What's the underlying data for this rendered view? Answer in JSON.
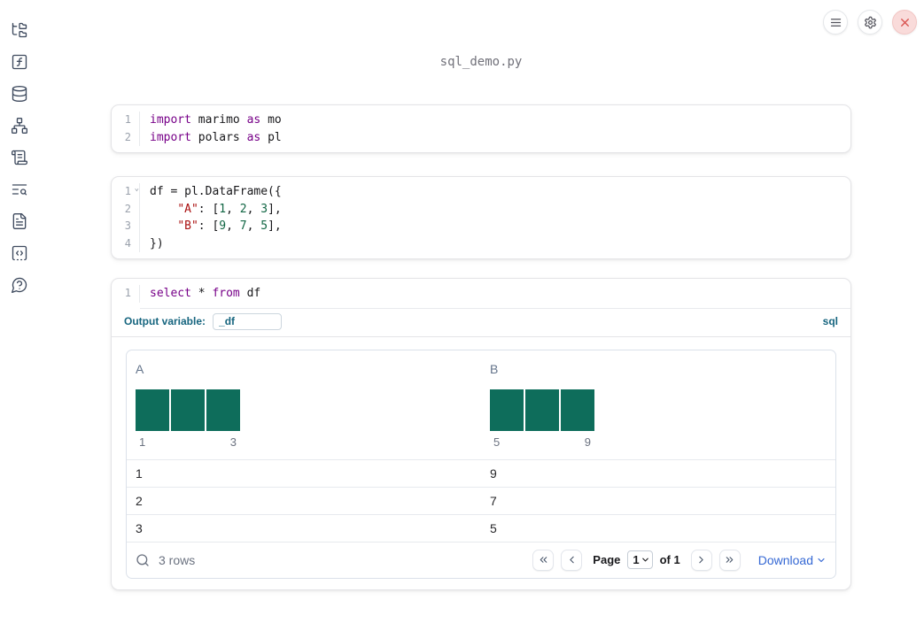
{
  "header": {
    "filename": "sql_demo.py",
    "buttons": {
      "menu": "menu-icon",
      "settings": "gear-icon",
      "close": "close-icon"
    }
  },
  "sidebar": {
    "icons": [
      "file-tree-icon",
      "function-square-icon",
      "database-icon",
      "dependency-graph-icon",
      "scratchpad-icon",
      "logs-search-icon",
      "documentation-icon",
      "snippets-icon",
      "help-icon"
    ]
  },
  "cells": [
    {
      "kind": "python",
      "lines": [
        {
          "n": "1",
          "tokens": [
            {
              "t": "kw",
              "v": "import"
            },
            {
              "t": "pl",
              "v": " marimo "
            },
            {
              "t": "kw",
              "v": "as"
            },
            {
              "t": "pl",
              "v": " mo"
            }
          ]
        },
        {
          "n": "2",
          "tokens": [
            {
              "t": "kw",
              "v": "import"
            },
            {
              "t": "pl",
              "v": " polars "
            },
            {
              "t": "kw",
              "v": "as"
            },
            {
              "t": "pl",
              "v": " pl"
            }
          ]
        }
      ]
    },
    {
      "kind": "python",
      "lines": [
        {
          "n": "1",
          "fold": true,
          "tokens": [
            {
              "t": "pl",
              "v": "df = pl.DataFrame({"
            }
          ]
        },
        {
          "n": "2",
          "tokens": [
            {
              "t": "pl",
              "v": "    "
            },
            {
              "t": "str",
              "v": "\"A\""
            },
            {
              "t": "pl",
              "v": ": ["
            },
            {
              "t": "num",
              "v": "1"
            },
            {
              "t": "pl",
              "v": ", "
            },
            {
              "t": "num",
              "v": "2"
            },
            {
              "t": "pl",
              "v": ", "
            },
            {
              "t": "num",
              "v": "3"
            },
            {
              "t": "pl",
              "v": "],"
            }
          ]
        },
        {
          "n": "3",
          "tokens": [
            {
              "t": "pl",
              "v": "    "
            },
            {
              "t": "str",
              "v": "\"B\""
            },
            {
              "t": "pl",
              "v": ": ["
            },
            {
              "t": "num",
              "v": "9"
            },
            {
              "t": "pl",
              "v": ", "
            },
            {
              "t": "num",
              "v": "7"
            },
            {
              "t": "pl",
              "v": ", "
            },
            {
              "t": "num",
              "v": "5"
            },
            {
              "t": "pl",
              "v": "],"
            }
          ]
        },
        {
          "n": "4",
          "tokens": [
            {
              "t": "pl",
              "v": "})"
            }
          ]
        }
      ]
    },
    {
      "kind": "sql",
      "lines": [
        {
          "n": "1",
          "tokens": [
            {
              "t": "kw",
              "v": "select"
            },
            {
              "t": "pl",
              "v": " * "
            },
            {
              "t": "kw",
              "v": "from"
            },
            {
              "t": "pl",
              "v": " df"
            }
          ]
        }
      ],
      "output_variable": {
        "label": "Output variable:",
        "value": "_df"
      },
      "language_badge": "sql"
    }
  ],
  "table": {
    "columns": [
      {
        "name": "A",
        "histogram": {
          "values": [
            1,
            1,
            1
          ],
          "min_label": "1",
          "max_label": "3"
        }
      },
      {
        "name": "B",
        "histogram": {
          "values": [
            1,
            1,
            1
          ],
          "min_label": "5",
          "max_label": "9"
        }
      }
    ],
    "rows": [
      [
        "1",
        "9"
      ],
      [
        "2",
        "7"
      ],
      [
        "3",
        "5"
      ]
    ],
    "footer": {
      "row_count": "3 rows",
      "page_label": "Page",
      "page_value": "1",
      "of_label": "of 1",
      "download_label": "Download"
    }
  },
  "colors": {
    "sidebar_icon": "#3e4a5e",
    "accent_blue": "#16657f",
    "histogram_bar": "#0e6d5b",
    "link_blue": "#3568d4",
    "keyword": "#770088",
    "string": "#aa1111",
    "number": "#116644",
    "close_red": "#d9534f"
  }
}
